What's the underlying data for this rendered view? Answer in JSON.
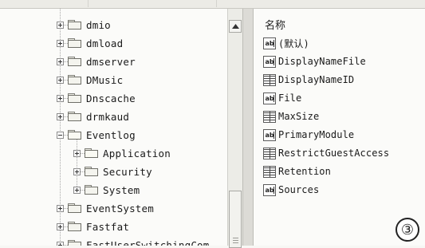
{
  "tree": {
    "items": [
      {
        "label": "dmio",
        "expanded": false
      },
      {
        "label": "dmload",
        "expanded": false
      },
      {
        "label": "dmserver",
        "expanded": false
      },
      {
        "label": "DMusic",
        "expanded": false
      },
      {
        "label": "Dnscache",
        "expanded": false
      },
      {
        "label": "drmkaud",
        "expanded": false
      },
      {
        "label": "Eventlog",
        "expanded": true
      },
      {
        "label": "Application",
        "expanded": false,
        "selected_folder": true
      },
      {
        "label": "Security",
        "expanded": false
      },
      {
        "label": "System",
        "expanded": false
      },
      {
        "label": "EventSystem",
        "expanded": false
      },
      {
        "label": "Fastfat",
        "expanded": false
      },
      {
        "label": "FastUserSwitchingCom",
        "expanded": false
      }
    ]
  },
  "values_pane": {
    "column_header": "名称",
    "rows": [
      {
        "name": "(默认)",
        "type": "string"
      },
      {
        "name": "DisplayNameFile",
        "type": "string"
      },
      {
        "name": "DisplayNameID",
        "type": "binary"
      },
      {
        "name": "File",
        "type": "string"
      },
      {
        "name": "MaxSize",
        "type": "binary"
      },
      {
        "name": "PrimaryModule",
        "type": "string"
      },
      {
        "name": "RestrictGuestAccess",
        "type": "binary"
      },
      {
        "name": "Retention",
        "type": "binary"
      },
      {
        "name": "Sources",
        "type": "string"
      }
    ]
  },
  "icon_text": {
    "string": "ab"
  },
  "badge": "③"
}
